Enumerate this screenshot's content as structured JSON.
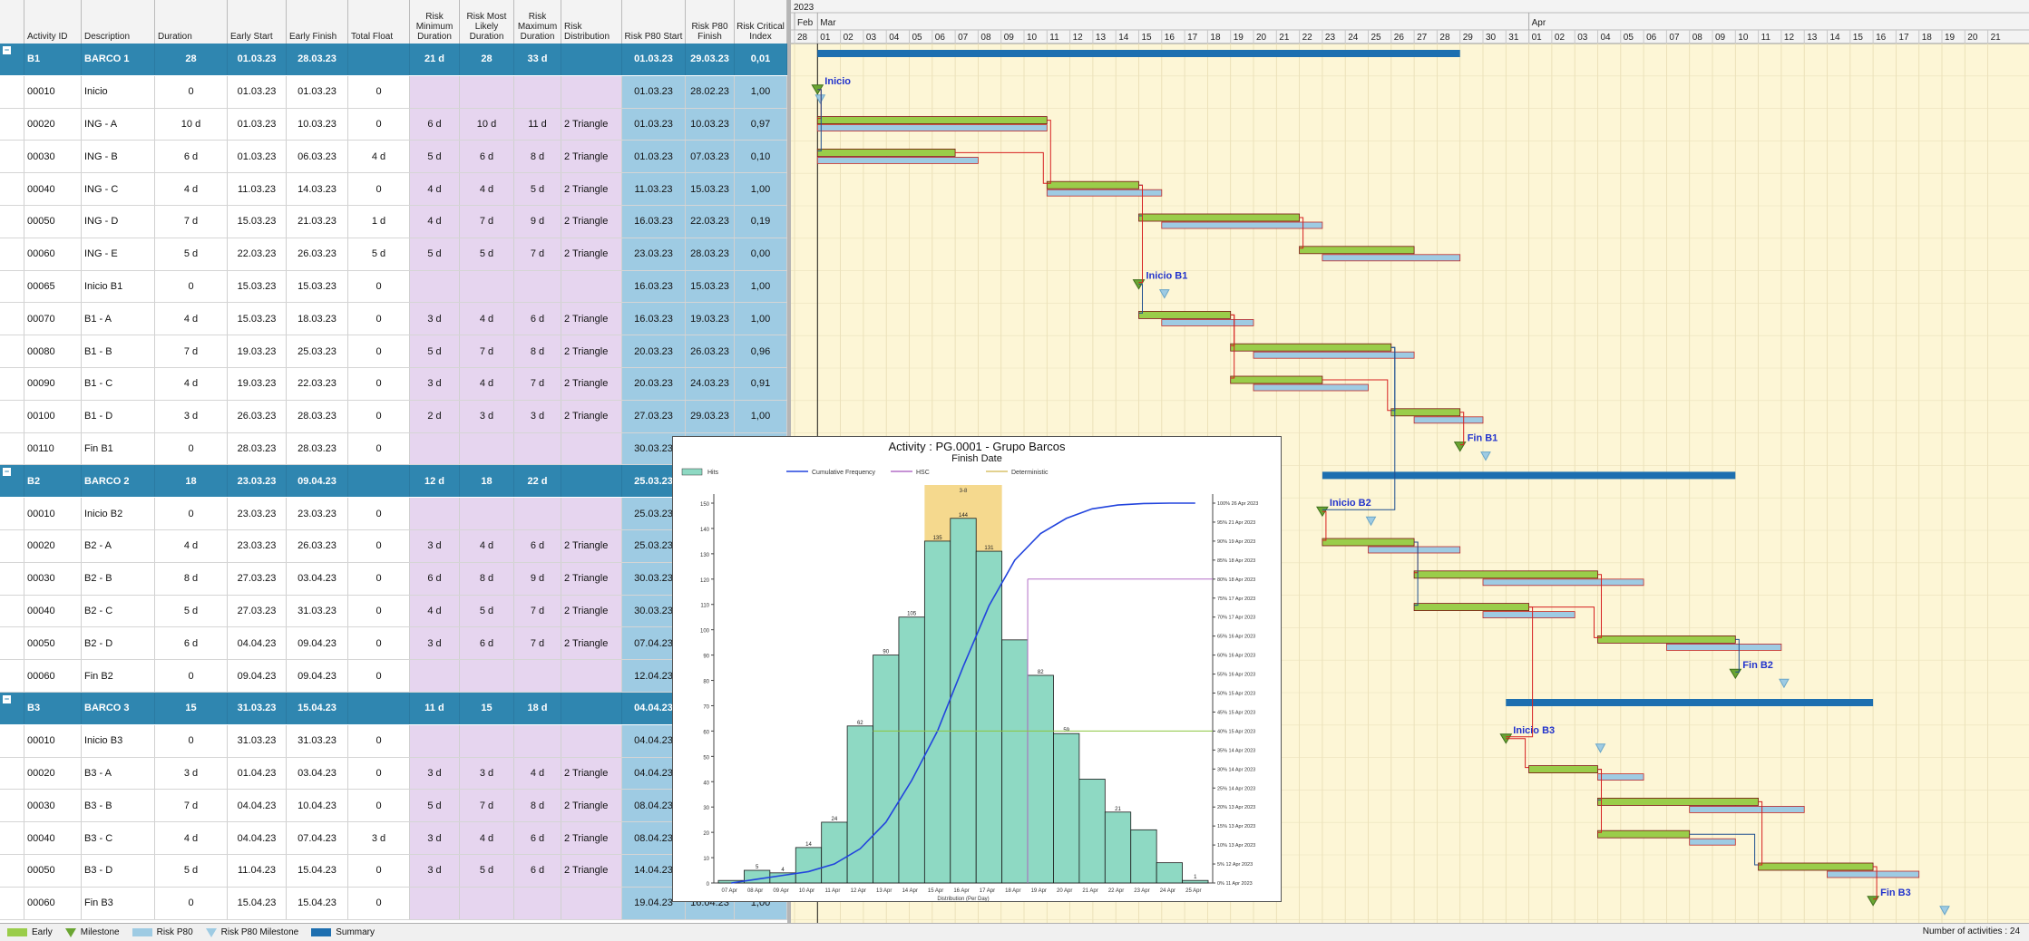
{
  "columns": [
    "Activity ID",
    "Description",
    "Duration",
    "Early Start",
    "Early Finish",
    "Total Float",
    "Risk Minimum Duration",
    "Risk Most Likely Duration",
    "Risk Maximum Duration",
    "Risk Distribution",
    "Risk P80 Start",
    "Risk P80 Finish",
    "Risk Critical Index"
  ],
  "rows": [
    {
      "type": "summary",
      "id": "B1",
      "desc": "BARCO 1",
      "dur": "28",
      "es": "01.03.23",
      "ef": "28.03.23",
      "tf": "",
      "rmin": "21 d",
      "rml": "28",
      "rmax": "33 d",
      "rdist": "",
      "p80s": "01.03.23",
      "p80f": "29.03.23",
      "rci": "0,01"
    },
    {
      "type": "task",
      "id": "00010",
      "desc": "Inicio",
      "dur": "0",
      "es": "01.03.23",
      "ef": "01.03.23",
      "tf": "0",
      "rmin": "",
      "rml": "",
      "rmax": "",
      "rdist": "",
      "p80s": "01.03.23",
      "p80f": "28.02.23",
      "rci": "1,00"
    },
    {
      "type": "task",
      "id": "00020",
      "desc": "ING - A",
      "dur": "10 d",
      "es": "01.03.23",
      "ef": "10.03.23",
      "tf": "0",
      "rmin": "6 d",
      "rml": "10 d",
      "rmax": "11 d",
      "rdist": "2 Triangle",
      "p80s": "01.03.23",
      "p80f": "10.03.23",
      "rci": "0,97"
    },
    {
      "type": "task",
      "id": "00030",
      "desc": "ING - B",
      "dur": "6 d",
      "es": "01.03.23",
      "ef": "06.03.23",
      "tf": "4 d",
      "rmin": "5 d",
      "rml": "6 d",
      "rmax": "8 d",
      "rdist": "2 Triangle",
      "p80s": "01.03.23",
      "p80f": "07.03.23",
      "rci": "0,10"
    },
    {
      "type": "task",
      "id": "00040",
      "desc": "ING - C",
      "dur": "4 d",
      "es": "11.03.23",
      "ef": "14.03.23",
      "tf": "0",
      "rmin": "4 d",
      "rml": "4 d",
      "rmax": "5 d",
      "rdist": "2 Triangle",
      "p80s": "11.03.23",
      "p80f": "15.03.23",
      "rci": "1,00"
    },
    {
      "type": "task",
      "id": "00050",
      "desc": "ING - D",
      "dur": "7 d",
      "es": "15.03.23",
      "ef": "21.03.23",
      "tf": "1 d",
      "rmin": "4 d",
      "rml": "7 d",
      "rmax": "9 d",
      "rdist": "2 Triangle",
      "p80s": "16.03.23",
      "p80f": "22.03.23",
      "rci": "0,19"
    },
    {
      "type": "task",
      "id": "00060",
      "desc": "ING - E",
      "dur": "5 d",
      "es": "22.03.23",
      "ef": "26.03.23",
      "tf": "5 d",
      "rmin": "5 d",
      "rml": "5 d",
      "rmax": "7 d",
      "rdist": "2 Triangle",
      "p80s": "23.03.23",
      "p80f": "28.03.23",
      "rci": "0,00"
    },
    {
      "type": "task",
      "id": "00065",
      "desc": "Inicio B1",
      "dur": "0",
      "es": "15.03.23",
      "ef": "15.03.23",
      "tf": "0",
      "rmin": "",
      "rml": "",
      "rmax": "",
      "rdist": "",
      "p80s": "16.03.23",
      "p80f": "15.03.23",
      "rci": "1,00"
    },
    {
      "type": "task",
      "id": "00070",
      "desc": "B1 - A",
      "dur": "4 d",
      "es": "15.03.23",
      "ef": "18.03.23",
      "tf": "0",
      "rmin": "3 d",
      "rml": "4 d",
      "rmax": "6 d",
      "rdist": "2 Triangle",
      "p80s": "16.03.23",
      "p80f": "19.03.23",
      "rci": "1,00"
    },
    {
      "type": "task",
      "id": "00080",
      "desc": "B1 - B",
      "dur": "7 d",
      "es": "19.03.23",
      "ef": "25.03.23",
      "tf": "0",
      "rmin": "5 d",
      "rml": "7 d",
      "rmax": "8 d",
      "rdist": "2 Triangle",
      "p80s": "20.03.23",
      "p80f": "26.03.23",
      "rci": "0,96"
    },
    {
      "type": "task",
      "id": "00090",
      "desc": "B1 - C",
      "dur": "4 d",
      "es": "19.03.23",
      "ef": "22.03.23",
      "tf": "0",
      "rmin": "3 d",
      "rml": "4 d",
      "rmax": "7 d",
      "rdist": "2 Triangle",
      "p80s": "20.03.23",
      "p80f": "24.03.23",
      "rci": "0,91"
    },
    {
      "type": "task",
      "id": "00100",
      "desc": "B1 - D",
      "dur": "3 d",
      "es": "26.03.23",
      "ef": "28.03.23",
      "tf": "0",
      "rmin": "2 d",
      "rml": "3 d",
      "rmax": "3 d",
      "rdist": "2 Triangle",
      "p80s": "27.03.23",
      "p80f": "29.03.23",
      "rci": "1,00"
    },
    {
      "type": "task",
      "id": "00110",
      "desc": "Fin B1",
      "dur": "0",
      "es": "28.03.23",
      "ef": "28.03.23",
      "tf": "0",
      "rmin": "",
      "rml": "",
      "rmax": "",
      "rdist": "",
      "p80s": "30.03.23",
      "p80f": "",
      "rci": ""
    },
    {
      "type": "summary",
      "id": "B2",
      "desc": "BARCO 2",
      "dur": "18",
      "es": "23.03.23",
      "ef": "09.04.23",
      "tf": "",
      "rmin": "12 d",
      "rml": "18",
      "rmax": "22 d",
      "rdist": "",
      "p80s": "25.03.23",
      "p80f": "",
      "rci": ""
    },
    {
      "type": "task",
      "id": "00010",
      "desc": "Inicio B2",
      "dur": "0",
      "es": "23.03.23",
      "ef": "23.03.23",
      "tf": "0",
      "rmin": "",
      "rml": "",
      "rmax": "",
      "rdist": "",
      "p80s": "25.03.23",
      "p80f": "",
      "rci": ""
    },
    {
      "type": "task",
      "id": "00020",
      "desc": "B2 - A",
      "dur": "4 d",
      "es": "23.03.23",
      "ef": "26.03.23",
      "tf": "0",
      "rmin": "3 d",
      "rml": "4 d",
      "rmax": "6 d",
      "rdist": "2 Triangle",
      "p80s": "25.03.23",
      "p80f": "",
      "rci": ""
    },
    {
      "type": "task",
      "id": "00030",
      "desc": "B2 - B",
      "dur": "8 d",
      "es": "27.03.23",
      "ef": "03.04.23",
      "tf": "0",
      "rmin": "6 d",
      "rml": "8 d",
      "rmax": "9 d",
      "rdist": "2 Triangle",
      "p80s": "30.03.23",
      "p80f": "",
      "rci": ""
    },
    {
      "type": "task",
      "id": "00040",
      "desc": "B2 - C",
      "dur": "5 d",
      "es": "27.03.23",
      "ef": "31.03.23",
      "tf": "0",
      "rmin": "4 d",
      "rml": "5 d",
      "rmax": "7 d",
      "rdist": "2 Triangle",
      "p80s": "30.03.23",
      "p80f": "",
      "rci": ""
    },
    {
      "type": "task",
      "id": "00050",
      "desc": "B2 - D",
      "dur": "6 d",
      "es": "04.04.23",
      "ef": "09.04.23",
      "tf": "0",
      "rmin": "3 d",
      "rml": "6 d",
      "rmax": "7 d",
      "rdist": "2 Triangle",
      "p80s": "07.04.23",
      "p80f": "",
      "rci": ""
    },
    {
      "type": "task",
      "id": "00060",
      "desc": "Fin B2",
      "dur": "0",
      "es": "09.04.23",
      "ef": "09.04.23",
      "tf": "0",
      "rmin": "",
      "rml": "",
      "rmax": "",
      "rdist": "",
      "p80s": "12.04.23",
      "p80f": "",
      "rci": ""
    },
    {
      "type": "summary",
      "id": "B3",
      "desc": "BARCO 3",
      "dur": "15",
      "es": "31.03.23",
      "ef": "15.04.23",
      "tf": "",
      "rmin": "11 d",
      "rml": "15",
      "rmax": "18 d",
      "rdist": "",
      "p80s": "04.04.23",
      "p80f": "",
      "rci": ""
    },
    {
      "type": "task",
      "id": "00010",
      "desc": "Inicio B3",
      "dur": "0",
      "es": "31.03.23",
      "ef": "31.03.23",
      "tf": "0",
      "rmin": "",
      "rml": "",
      "rmax": "",
      "rdist": "",
      "p80s": "04.04.23",
      "p80f": "",
      "rci": ""
    },
    {
      "type": "task",
      "id": "00020",
      "desc": "B3 - A",
      "dur": "3 d",
      "es": "01.04.23",
      "ef": "03.04.23",
      "tf": "0",
      "rmin": "3 d",
      "rml": "3 d",
      "rmax": "4 d",
      "rdist": "2 Triangle",
      "p80s": "04.04.23",
      "p80f": "",
      "rci": ""
    },
    {
      "type": "task",
      "id": "00030",
      "desc": "B3 - B",
      "dur": "7 d",
      "es": "04.04.23",
      "ef": "10.04.23",
      "tf": "0",
      "rmin": "5 d",
      "rml": "7 d",
      "rmax": "8 d",
      "rdist": "2 Triangle",
      "p80s": "08.04.23",
      "p80f": "",
      "rci": ""
    },
    {
      "type": "task",
      "id": "00040",
      "desc": "B3 - C",
      "dur": "4 d",
      "es": "04.04.23",
      "ef": "07.04.23",
      "tf": "3 d",
      "rmin": "3 d",
      "rml": "4 d",
      "rmax": "6 d",
      "rdist": "2 Triangle",
      "p80s": "08.04.23",
      "p80f": "",
      "rci": ""
    },
    {
      "type": "task",
      "id": "00050",
      "desc": "B3 - D",
      "dur": "5 d",
      "es": "11.04.23",
      "ef": "15.04.23",
      "tf": "0",
      "rmin": "3 d",
      "rml": "5 d",
      "rmax": "6 d",
      "rdist": "2 Triangle",
      "p80s": "14.04.23",
      "p80f": "",
      "rci": ""
    },
    {
      "type": "task",
      "id": "00060",
      "desc": "Fin B3",
      "dur": "0",
      "es": "15.04.23",
      "ef": "15.04.23",
      "tf": "0",
      "rmin": "",
      "rml": "",
      "rmax": "",
      "rdist": "",
      "p80s": "19.04.23",
      "p80f": "16.04.23",
      "rci": "1,00"
    }
  ],
  "timescale": {
    "year": "2023",
    "months": [
      "Feb",
      "Mar",
      "Apr"
    ],
    "days": [
      "28",
      "01",
      "02",
      "03",
      "04",
      "05",
      "06",
      "07",
      "08",
      "09",
      "10",
      "11",
      "12",
      "13",
      "14",
      "15",
      "16",
      "17",
      "18",
      "19",
      "20",
      "21",
      "22",
      "23",
      "24",
      "25",
      "26",
      "27",
      "28",
      "29",
      "30",
      "31",
      "01",
      "02",
      "03",
      "04",
      "05",
      "06",
      "07",
      "08",
      "09",
      "10",
      "11",
      "12",
      "13",
      "14",
      "15",
      "16",
      "17",
      "18",
      "19",
      "20",
      "21"
    ]
  },
  "milestone_labels": [
    "Inicio",
    "Inicio B1",
    "Fin B1",
    "Inicio B2",
    "Fin B2",
    "Inicio B3",
    "Fin B3"
  ],
  "legend": [
    {
      "label": "Early",
      "color": "#9acd4a"
    },
    {
      "label": "Milestone",
      "color": "#6aa532"
    },
    {
      "label": "Risk P80",
      "color": "#9ecbe3"
    },
    {
      "label": "Risk P80 Milestone",
      "color": "#9ecbe3"
    },
    {
      "label": "Summary",
      "color": "#1d6fb0"
    }
  ],
  "footer": {
    "count": "Number of activities : 24"
  },
  "popup": {
    "title": "Activity : PG.0001 - Grupo Barcos",
    "subtitle": "Finish Date",
    "legend": [
      "Hits",
      "Cumulative Frequency",
      "HSC",
      "Deterministic"
    ]
  },
  "chart_data": {
    "type": "bar",
    "title": "Activity : PG.0001 - Grupo Barcos",
    "subtitle": "Finish Date",
    "xlabel": "Distribution (Per Day)",
    "categories": [
      "07 Apr",
      "08 Apr",
      "09 Apr",
      "10 Apr",
      "11 Apr",
      "12 Apr",
      "13 Apr",
      "14 Apr",
      "15 Apr",
      "16 Apr",
      "17 Apr",
      "18 Apr",
      "19 Apr",
      "20 Apr",
      "21 Apr",
      "22 Apr",
      "23 Apr",
      "24 Apr",
      "25 Apr"
    ],
    "values": [
      1,
      5,
      4,
      14,
      24,
      62,
      90,
      105,
      135,
      144,
      131,
      96,
      82,
      59,
      41,
      28,
      21,
      8,
      1
    ],
    "value_labels": [
      "",
      "5",
      "4",
      "14",
      "24",
      "62",
      "90",
      "105",
      "135",
      "144",
      "131",
      "",
      "82",
      "59",
      "",
      "21",
      "",
      "",
      "1"
    ],
    "highlight_label": "3-8",
    "ylim": [
      0,
      150
    ],
    "y_ticks": [
      "0",
      "10",
      "20",
      "30",
      "40",
      "50",
      "60",
      "70",
      "80",
      "90",
      "100",
      "110",
      "120",
      "130",
      "140",
      "150"
    ],
    "cumulative": [
      0,
      1,
      2,
      3,
      5,
      9,
      16,
      27,
      40,
      57,
      73,
      85,
      92,
      96,
      98.5,
      99.5,
      99.9,
      100,
      100
    ],
    "right_ticks": [
      "0%  11 Apr 2023",
      "5%  12 Apr 2023",
      "10%  13 Apr 2023",
      "15%  13 Apr 2023",
      "20%  13 Apr 2023",
      "25%  14 Apr 2023",
      "30%  14 Apr 2023",
      "35%  14 Apr 2023",
      "40%  15 Apr 2023",
      "45%  15 Apr 2023",
      "50%  15 Apr 2023",
      "55%  16 Apr 2023",
      "60%  16 Apr 2023",
      "65%  16 Apr 2023",
      "70%  17 Apr 2023",
      "75%  17 Apr 2023",
      "80%  18 Apr 2023",
      "85%  18 Apr 2023",
      "90%  19 Apr 2023",
      "95%  21 Apr 2023",
      "100%  26 Apr 2023"
    ],
    "series": [
      {
        "name": "Hits",
        "color": "#8ed9c3"
      },
      {
        "name": "Cumulative Frequency",
        "color": "#2244dd"
      },
      {
        "name": "HSC",
        "color": "#b36fc7"
      },
      {
        "name": "Deterministic",
        "color": "#d9c26a"
      }
    ]
  }
}
